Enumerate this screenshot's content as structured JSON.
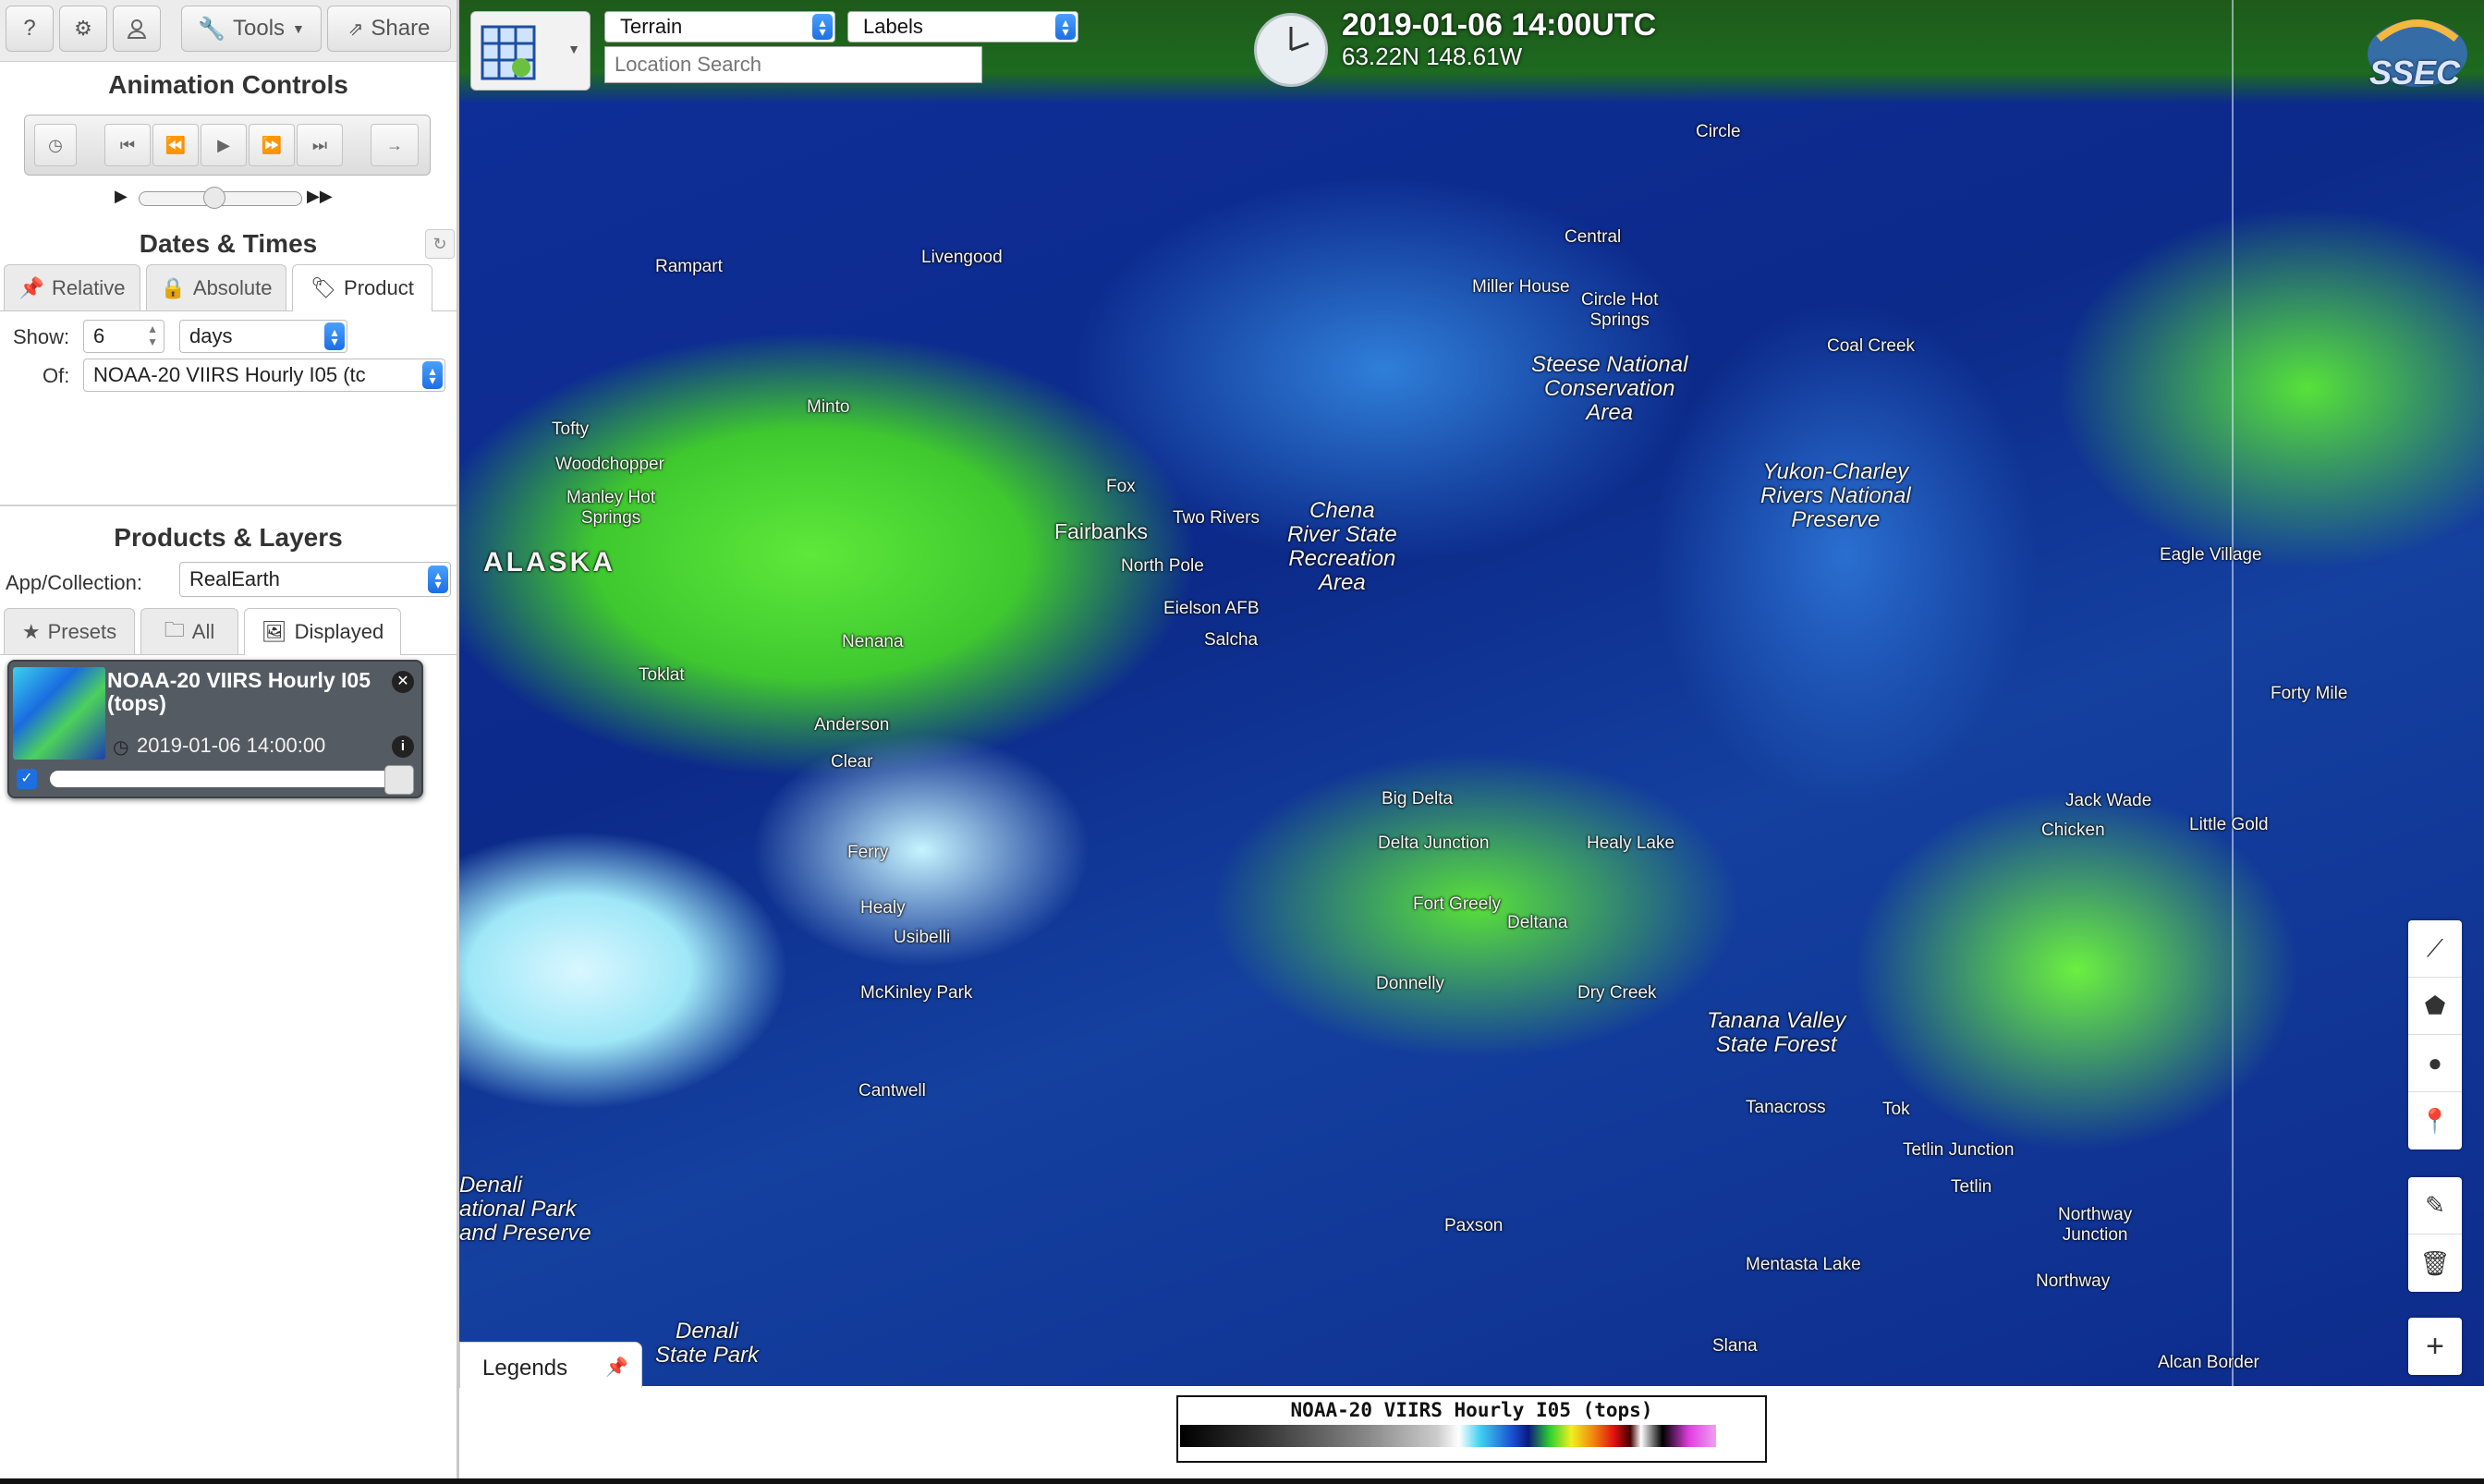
{
  "toolbar": {
    "help": "?",
    "settings": "⚙",
    "user": "👤",
    "tools_label": "Tools",
    "share_label": "Share"
  },
  "animation": {
    "title": "Animation Controls"
  },
  "dates": {
    "title": "Dates & Times",
    "tabs": [
      "Relative",
      "Absolute",
      "Product"
    ],
    "active_tab": "Product",
    "show_label": "Show:",
    "show_value": "6",
    "unit_value": "days",
    "of_label": "Of:",
    "of_value": "NOAA-20 VIIRS Hourly I05 (tc"
  },
  "products": {
    "title": "Products & Layers",
    "collection_label": "App/Collection:",
    "collection_value": "RealEarth",
    "tabs": [
      "Presets",
      "All",
      "Displayed"
    ],
    "active_tab": "Displayed"
  },
  "layer": {
    "title": "NOAA-20 VIIRS Hourly I05 (tops)",
    "time": "2019-01-06 14:00:00",
    "visible": true
  },
  "map": {
    "basemap_value": "Terrain",
    "labels_value": "Labels",
    "search_placeholder": "Location Search",
    "datetime": "2019-01-06 14:00UTC",
    "coords": "63.22N 148.61W",
    "logo_text": "SSEC",
    "places": {
      "circle": "Circle",
      "central": "Central",
      "miller_house": "Miller House",
      "circle_hot_springs": "Circle Hot\nSprings",
      "steese": "Steese National\nConservation\nArea",
      "coal_creek": "Coal Creek",
      "yukon_charley": "Yukon-Charley\nRivers National\nPreserve",
      "eagle_village": "Eagle Village",
      "livengood": "Livengood",
      "rampart": "Rampart",
      "minto": "Minto",
      "tofty": "Tofty",
      "woodchopper": "Woodchopper",
      "manley": "Manley Hot\nSprings",
      "alaska": "ALASKA",
      "fox": "Fox",
      "fairbanks": "Fairbanks",
      "two_rivers": "Two Rivers",
      "chena": "Chena\nRiver State\nRecreation\nArea",
      "north_pole": "North Pole",
      "eielson": "Eielson AFB",
      "salcha": "Salcha",
      "nenana": "Nenana",
      "toklat": "Toklat",
      "forty_mile": "Forty Mile",
      "anderson": "Anderson",
      "clear": "Clear",
      "big_delta": "Big Delta",
      "delta_junction": "Delta Junction",
      "healy_lake": "Healy Lake",
      "jack_wade": "Jack Wade",
      "chicken": "Chicken",
      "little_gold": "Little Gold",
      "ferry": "Ferry",
      "healy": "Healy",
      "usibelli": "Usibelli",
      "fort_greely": "Fort Greely",
      "deltana": "Deltana",
      "mckinley_park": "McKinley Park",
      "donnelly": "Donnelly",
      "dry_creek": "Dry Creek",
      "tanana_valley": "Tanana Valley\nState Forest",
      "cantwell": "Cantwell",
      "tanacross": "Tanacross",
      "tok": "Tok",
      "tetlin_junction": "Tetlin Junction",
      "tetlin": "Tetlin",
      "denali_np": "Denali\national Park\nand Preserve",
      "paxson": "Paxson",
      "northway_junction": "Northway\nJunction",
      "mentasta": "Mentasta Lake",
      "northway": "Northway",
      "denali_sp": "Denali\nState Park",
      "slana": "Slana",
      "alcan": "Alcan Border"
    }
  },
  "legend": {
    "tab_label": "Legends",
    "title": "NOAA-20 VIIRS Hourly I05 (tops)"
  },
  "colors": {
    "accent_blue": "#1d6fe0",
    "panel_bg": "#ececec"
  }
}
